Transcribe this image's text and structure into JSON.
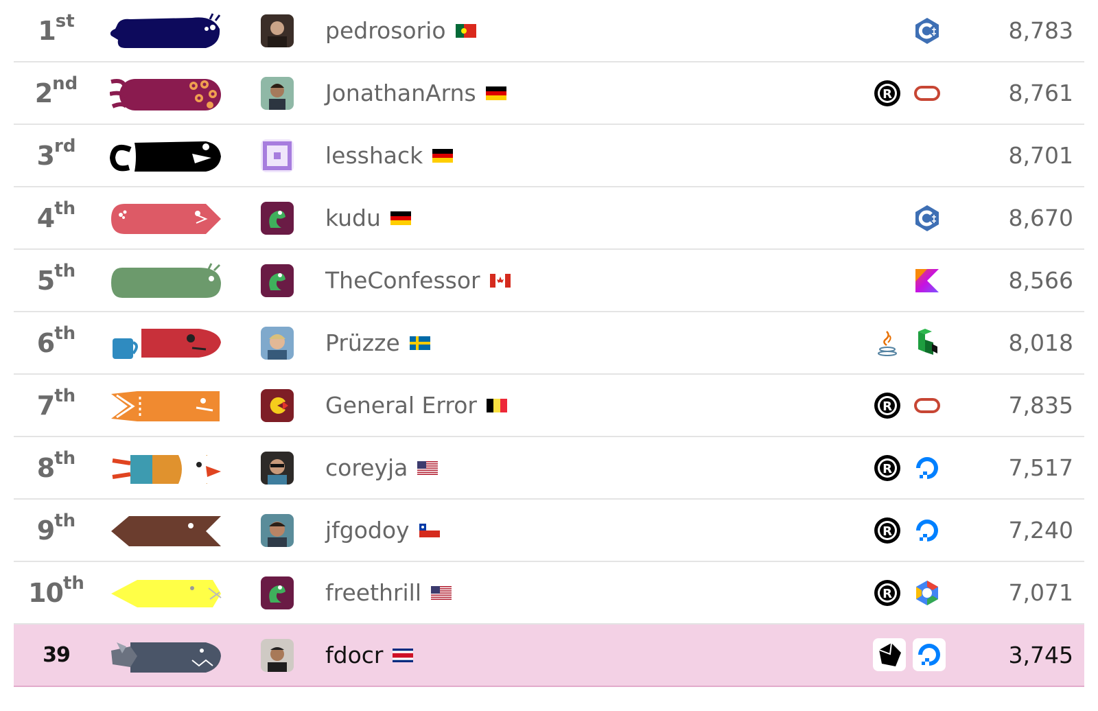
{
  "leaderboard": {
    "rows": [
      {
        "rank": "1",
        "suffix": "st",
        "name": "pedrosorio",
        "flag": "portugal",
        "icons": [
          "cpp-icon"
        ],
        "score": "8,783",
        "snake": "navy-snail"
      },
      {
        "rank": "2",
        "suffix": "nd",
        "name": "JonathanArns",
        "flag": "germany",
        "icons": [
          "rust-icon",
          "oracle-icon"
        ],
        "score": "8,761",
        "snake": "maroon-octopus"
      },
      {
        "rank": "3",
        "suffix": "rd",
        "name": "lesshack",
        "flag": "germany",
        "icons": [],
        "score": "8,701",
        "snake": "black-pirate"
      },
      {
        "rank": "4",
        "suffix": "th",
        "name": "kudu",
        "flag": "germany",
        "icons": [
          "cpp-icon"
        ],
        "score": "8,670",
        "snake": "red-bubble"
      },
      {
        "rank": "5",
        "suffix": "th",
        "name": "TheConfessor",
        "flag": "canada",
        "icons": [
          "kotlin-icon"
        ],
        "score": "8,566",
        "snake": "green-snail"
      },
      {
        "rank": "6",
        "suffix": "th",
        "name": "Prüzze",
        "flag": "sweden",
        "icons": [
          "java-icon",
          "linode-icon"
        ],
        "score": "8,018",
        "snake": "red-mug"
      },
      {
        "rank": "7",
        "suffix": "th",
        "name": "General Error",
        "flag": "belgium",
        "icons": [
          "rust-icon",
          "oracle-icon"
        ],
        "score": "7,835",
        "snake": "orange-flame"
      },
      {
        "rank": "8",
        "suffix": "th",
        "name": "coreyja",
        "flag": "usa",
        "icons": [
          "rust-icon",
          "digitalocean-icon"
        ],
        "score": "7,517",
        "snake": "puffin"
      },
      {
        "rank": "9",
        "suffix": "th",
        "name": "jfgodoy",
        "flag": "chile",
        "icons": [
          "rust-icon",
          "digitalocean-icon"
        ],
        "score": "7,240",
        "snake": "brown-arrow"
      },
      {
        "rank": "10",
        "suffix": "th",
        "name": "freethrill",
        "flag": "usa",
        "icons": [
          "rust-icon",
          "gcp-icon"
        ],
        "score": "7,071",
        "snake": "yellow-arrow"
      }
    ],
    "current_user": {
      "rank": "39",
      "suffix": "",
      "name": "fdocr",
      "flag": "costa-rica",
      "icons": [
        "cube-icon",
        "digitalocean-icon"
      ],
      "score": "3,745",
      "snake": "gray-shark"
    }
  },
  "colors": {
    "highlight_row": "#f3d1e5",
    "text_muted": "#666666",
    "divider": "#e4e4e4"
  }
}
